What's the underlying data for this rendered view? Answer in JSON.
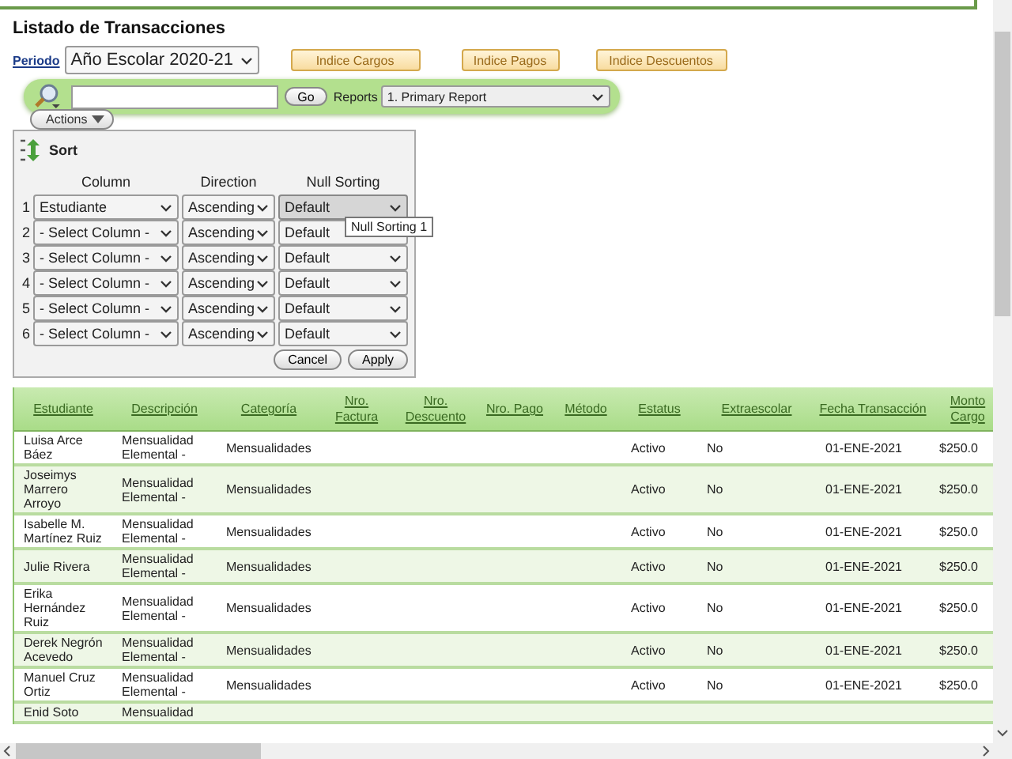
{
  "page_title": "Listado de Transacciones",
  "period": {
    "label": "Periodo",
    "value": "Año Escolar 2020-21"
  },
  "index_buttons": [
    "Indice Cargos",
    "Indice Pagos",
    "Indice Descuentos"
  ],
  "search": {
    "button": "Go",
    "reports_label": "Reports",
    "report": "1. Primary Report"
  },
  "actions_button": "Actions",
  "sort_panel": {
    "title": "Sort",
    "headers": [
      "Column",
      "Direction",
      "Null Sorting"
    ],
    "rows": [
      {
        "number": "1",
        "column": "Estudiante",
        "direction": "Ascending",
        "null_sorting": "Default",
        "hovered": true
      },
      {
        "number": "2",
        "column": "- Select Column -",
        "direction": "Ascending",
        "null_sorting": "Default",
        "hovered": false
      },
      {
        "number": "3",
        "column": "- Select Column -",
        "direction": "Ascending",
        "null_sorting": "Default",
        "hovered": false
      },
      {
        "number": "4",
        "column": "- Select Column -",
        "direction": "Ascending",
        "null_sorting": "Default",
        "hovered": false
      },
      {
        "number": "5",
        "column": "- Select Column -",
        "direction": "Ascending",
        "null_sorting": "Default",
        "hovered": false
      },
      {
        "number": "6",
        "column": "- Select Column -",
        "direction": "Ascending",
        "null_sorting": "Default",
        "hovered": false
      }
    ],
    "buttons": [
      "Cancel",
      "Apply"
    ],
    "tooltip": "Null Sorting 1"
  },
  "table": {
    "columns": [
      "Estudiante",
      "Descripción",
      "Categoría",
      "Nro. Factura",
      "Nro. Descuento",
      "Nro. Pago",
      "Método",
      "Estatus",
      "Extraescolar",
      "Fecha Transacción",
      "Monto Cargo"
    ],
    "rows": [
      {
        "student": "Luisa Arce Báez",
        "description": "Mensualidad Elemental -",
        "category": "Mensualidades",
        "status": "Activo",
        "extracurricular": "No",
        "date": "01-ENE-2021",
        "amount": "$250.0"
      },
      {
        "student": "Joseimys Marrero Arroyo",
        "description": "Mensualidad Elemental -",
        "category": "Mensualidades",
        "status": "Activo",
        "extracurricular": "No",
        "date": "01-ENE-2021",
        "amount": "$250.0"
      },
      {
        "student": "Isabelle M. Martínez Ruiz",
        "description": "Mensualidad Elemental -",
        "category": "Mensualidades",
        "status": "Activo",
        "extracurricular": "No",
        "date": "01-ENE-2021",
        "amount": "$250.0"
      },
      {
        "student": "Julie Rivera",
        "description": "Mensualidad Elemental -",
        "category": "Mensualidades",
        "status": "Activo",
        "extracurricular": "No",
        "date": "01-ENE-2021",
        "amount": "$250.0"
      },
      {
        "student": "Erika Hernández Ruiz",
        "description": "Mensualidad Elemental -",
        "category": "Mensualidades",
        "status": "Activo",
        "extracurricular": "No",
        "date": "01-ENE-2021",
        "amount": "$250.0"
      },
      {
        "student": "Derek Negrón Acevedo",
        "description": "Mensualidad Elemental -",
        "category": "Mensualidades",
        "status": "Activo",
        "extracurricular": "No",
        "date": "01-ENE-2021",
        "amount": "$250.0"
      },
      {
        "student": "Manuel Cruz Ortiz",
        "description": "Mensualidad Elemental -",
        "category": "Mensualidades",
        "status": "Activo",
        "extracurricular": "No",
        "date": "01-ENE-2021",
        "amount": "$250.0"
      },
      {
        "student": "Enid Soto",
        "description": "Mensualidad"
      }
    ]
  }
}
